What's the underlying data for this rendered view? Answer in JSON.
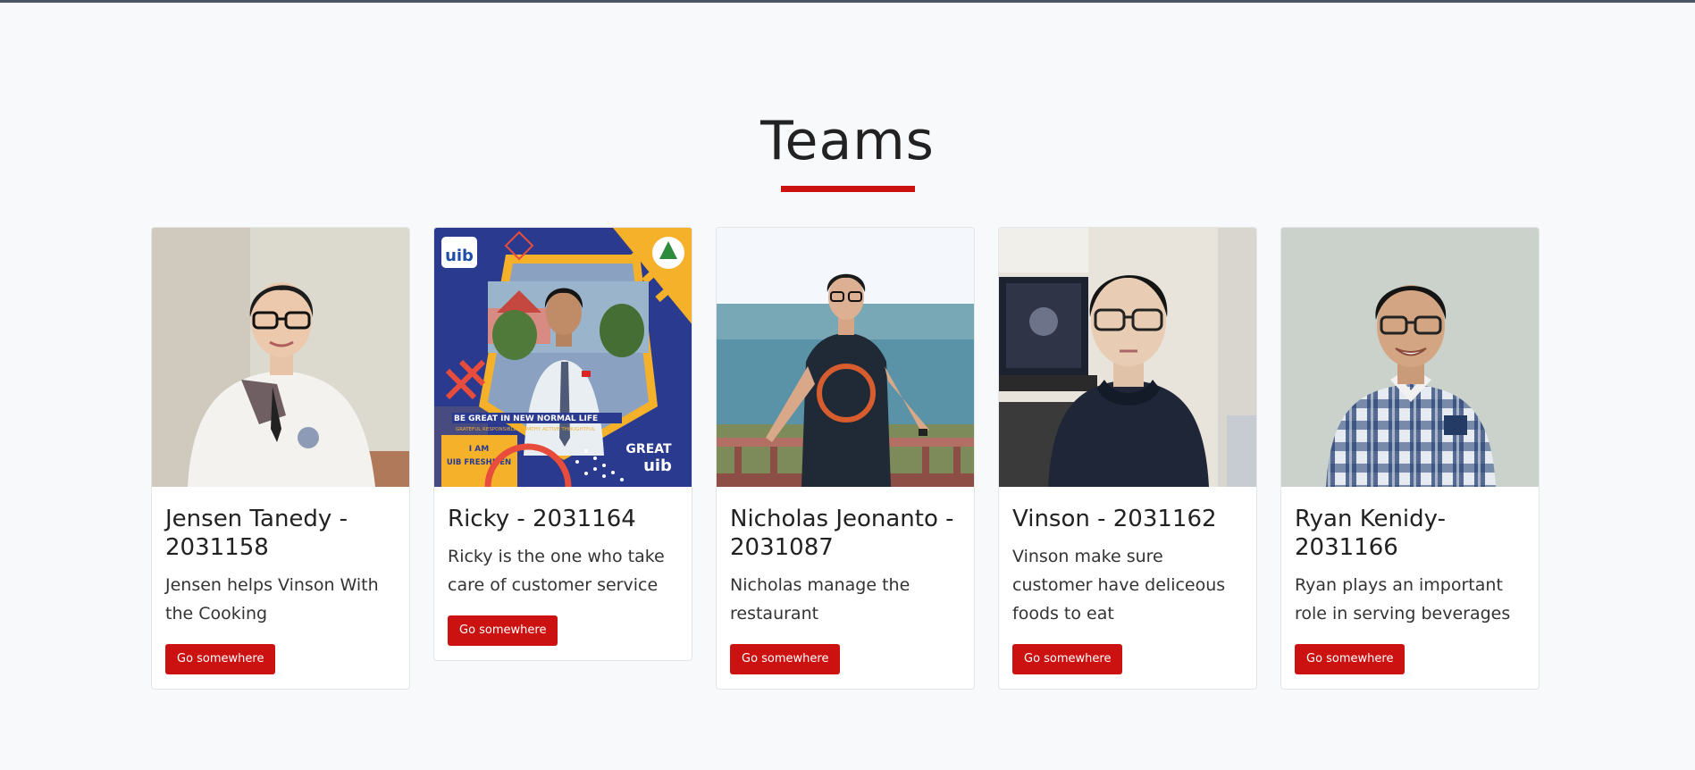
{
  "page": {
    "heading": "Teams"
  },
  "cards": [
    {
      "title": "Jensen Tanedy - 2031158",
      "text": "Jensen helps Vinson With the Cooking",
      "button": "Go somewhere"
    },
    {
      "title": "Ricky - 2031164",
      "text": "Ricky is the one who take care of customer service",
      "button": "Go somewhere",
      "photo_text": {
        "logo": "uib",
        "banner": "BE GREAT IN NEW NORMAL LIFE",
        "slogan": "GRATEFUL RESPONSIBLE EMPATHY ACTIVE THOUGHTFUL",
        "badge_1": "I AM",
        "badge_2": "UIB FRESHMEN",
        "great_1": "GREAT",
        "great_2": "uib"
      }
    },
    {
      "title": "Nicholas Jeonanto - 2031087",
      "text": "Nicholas manage the restaurant",
      "button": "Go somewhere"
    },
    {
      "title": "Vinson - 2031162",
      "text": "Vinson make sure customer have deliceous foods to eat",
      "button": "Go somewhere"
    },
    {
      "title": "Ryan Kenidy- 2031166",
      "text": "Ryan plays an important role in serving beverages",
      "button": "Go somewhere"
    }
  ],
  "colors": {
    "accent": "#cc1111",
    "background": "#f8f9fb",
    "card_border": "#e3e5e8"
  }
}
